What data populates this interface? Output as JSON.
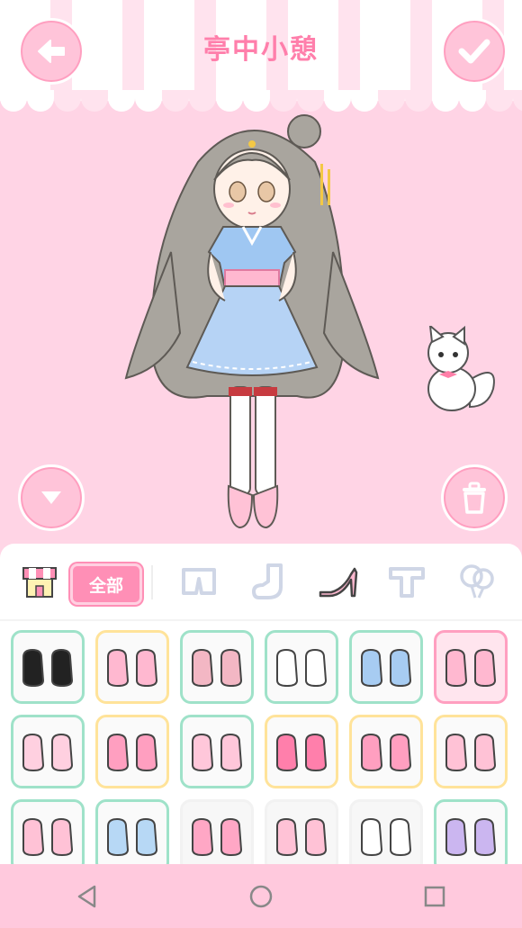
{
  "header": {
    "title": "亭中小憩"
  },
  "tabs": {
    "shop_icon": "shop-icon",
    "all_label": "全部",
    "categories": [
      "shorts-icon",
      "sock-icon",
      "high-heel-icon",
      "shirt-icon",
      "balloon-icon"
    ],
    "selected": "high-heel-icon"
  },
  "items": [
    {
      "name": "black-boots",
      "border": "green"
    },
    {
      "name": "bunny-black-white-shoes",
      "border": "yellow"
    },
    {
      "name": "sneakers-pink",
      "border": "green"
    },
    {
      "name": "cat-face-slippers",
      "border": "green"
    },
    {
      "name": "blue-sneakers",
      "border": "green"
    },
    {
      "name": "pink-flats",
      "border": "pink"
    },
    {
      "name": "ribbon-socks-shoes",
      "border": "green"
    },
    {
      "name": "pink-bow-sandals",
      "border": "yellow"
    },
    {
      "name": "pink-mary-janes",
      "border": "green"
    },
    {
      "name": "pink-bow-boots",
      "border": "yellow"
    },
    {
      "name": "pink-lace-boots",
      "border": "yellow"
    },
    {
      "name": "bunny-pink-flats",
      "border": "yellow"
    },
    {
      "name": "pink-ballet-shoes",
      "border": "green"
    },
    {
      "name": "blue-bunny-flats",
      "border": "green"
    },
    {
      "name": "pink-strap-shoes",
      "border": "none"
    },
    {
      "name": "pig-slippers",
      "border": "none"
    },
    {
      "name": "white-strap-sandals",
      "border": "none"
    },
    {
      "name": "purple-lace-flats",
      "border": "green"
    }
  ],
  "colors": {
    "accent": "#ff8fb6",
    "background": "#ffd4e5",
    "green_border": "#9fe2c9",
    "yellow_border": "#ffe39a"
  }
}
